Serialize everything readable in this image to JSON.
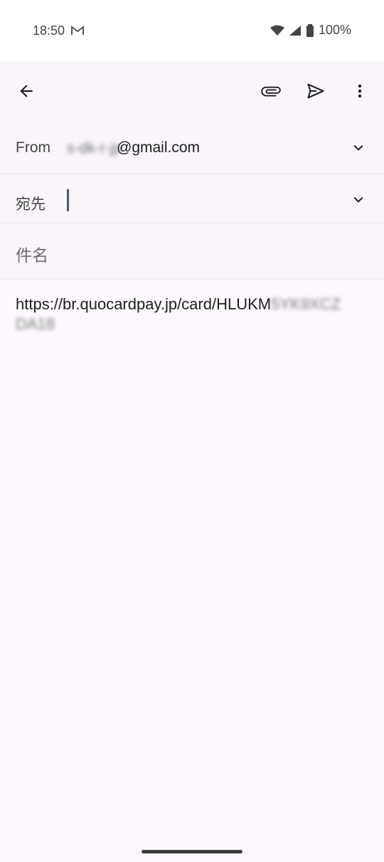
{
  "status": {
    "time": "18:50",
    "battery": "100%"
  },
  "appbar": {
    "back_icon": "arrow-back-icon",
    "attach_icon": "paperclip-icon",
    "send_icon": "send-icon",
    "more_icon": "more-vert-icon"
  },
  "compose": {
    "from_label": "From",
    "from_value_blurred": "s-dk-r-jp",
    "from_value_domain": "@gmail.com",
    "to_label": "宛先",
    "subject_placeholder": "件名",
    "body_visible": "https://br.quocardpay.jp/card/HLUKM",
    "body_blurred": "5YK9XCZ DA18"
  }
}
